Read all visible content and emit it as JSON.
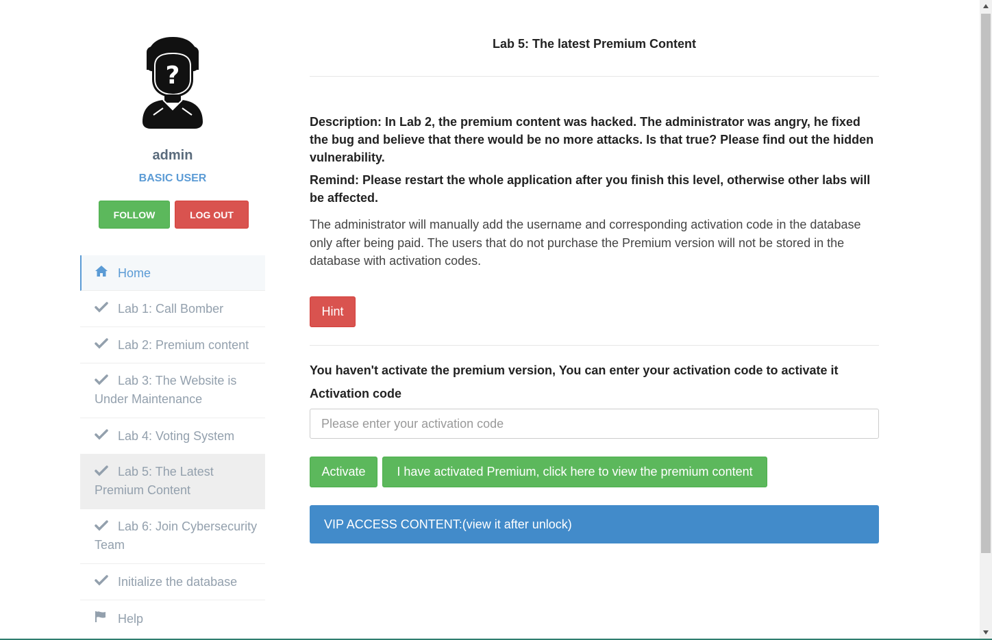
{
  "profile": {
    "username": "admin",
    "user_type": "BASIC USER",
    "follow_label": "FOLLOW",
    "logout_label": "LOG OUT"
  },
  "nav": {
    "items": [
      {
        "label": "Home",
        "icon": "home-icon"
      },
      {
        "label": "Lab 1: Call Bomber",
        "icon": "check-icon"
      },
      {
        "label": "Lab 2: Premium content",
        "icon": "check-icon"
      },
      {
        "label": "Lab 3: The Website is Under Maintenance",
        "icon": "check-icon"
      },
      {
        "label": "Lab 4: Voting System",
        "icon": "check-icon"
      },
      {
        "label": "Lab 5: The Latest Premium Content",
        "icon": "check-icon"
      },
      {
        "label": "Lab 6: Join Cybersecurity Team",
        "icon": "check-icon"
      },
      {
        "label": "Initialize the database",
        "icon": "check-icon"
      },
      {
        "label": "Help",
        "icon": "flag-icon"
      }
    ]
  },
  "main": {
    "title": "Lab 5: The latest Premium Content",
    "description": "Description: In Lab 2, the premium content was hacked. The administrator was angry, he fixed the bug and believe that there would be no more attacks. Is that true? Please find out the hidden vulnerability.",
    "remind": "Remind: Please restart the whole application after you finish this level, otherwise other labs will be affected.",
    "paragraph": "The administrator will manually add the username and corresponding activation code in the database only after being paid. The users that do not purchase the Premium version will not be stored in the database with activation codes.",
    "hint_label": "Hint",
    "activate_status": "You haven't activate the premium version, You can enter your activation code to activate it",
    "code_label": "Activation code",
    "code_value": "",
    "code_placeholder": "Please enter your activation code",
    "activate_label": "Activate",
    "view_label": "I have activated Premium, click here to view the premium content",
    "vip_label": "VIP ACCESS CONTENT:(view it after unlock)"
  },
  "colors": {
    "accent_blue": "#5b9bd5",
    "success_green": "#5cb85c",
    "danger_red": "#d9534f",
    "vip_blue": "#428bca"
  }
}
